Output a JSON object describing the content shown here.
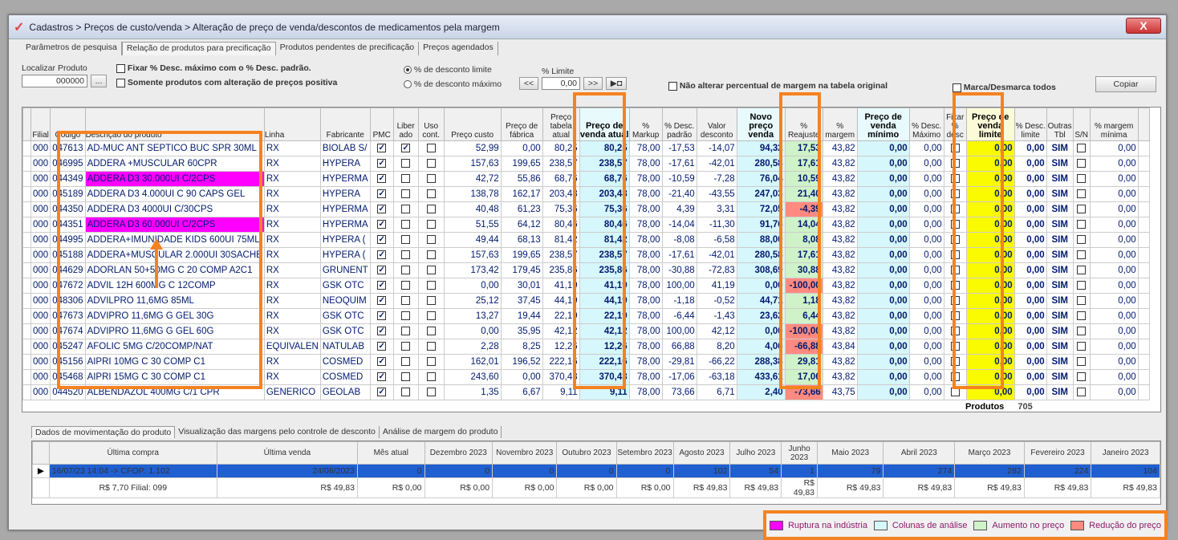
{
  "window": {
    "title": "Cadastros > Preços de custo/venda > Alteração de preço de venda/descontos de medicamentos pela margem",
    "close": "X"
  },
  "tabs": [
    "Parâmetros de pesquisa",
    "Relação de produtos para precificação",
    "Produtos pendentes de precificação",
    "Preços agendados"
  ],
  "filters": {
    "search_label": "Localizar Produto",
    "search_value": "000000",
    "search_btn": "...",
    "fix_desc": "Fixar % Desc. máximo com o % Desc. padrão.",
    "only_positive": "Somente produtos com alteração de preços positiva",
    "radio_limit": "% de desconto limite",
    "radio_max": "% de desconto máximo",
    "limit_label": "% Limite",
    "limit_value": "0,00",
    "nav_prev": "<<",
    "nav_next": ">>",
    "nav_end": "▶◘",
    "no_change_margin": "Não alterar percentual de margem na tabela original",
    "mark_all": "Marca/Desmarca todos",
    "copy_btn": "Copiar"
  },
  "grid": {
    "headers": [
      "Filial",
      "Código",
      "Descrição do produto",
      "Linha",
      "Fabricante",
      "PMC",
      "Liber ado",
      "Uso cont.",
      "Preço custo",
      "Preço de fábrica",
      "Preço tabela atual",
      "Preço de venda atual",
      "% Markup",
      "% Desc. padrão",
      "Valor desconto",
      "Novo preço venda",
      "% Reajuste",
      "% margem",
      "Preço de venda mínimo",
      "% Desc. Máximo",
      "Fixar % desc",
      "Preço de venda limite",
      "% Desc. limite",
      "Outras Tbl",
      "S/N",
      "% margem mínima"
    ],
    "rows": [
      {
        "filial": "000",
        "codigo": "047613",
        "desc": "AD-MUC ANT SEPTICO BUC SPR 30ML",
        "linha": "RX",
        "fab": "BIOLAB S/",
        "pmc": true,
        "lib": true,
        "uso": false,
        "custo": "52,99",
        "fabrica": "0,00",
        "tabela": "80,25",
        "venda": "80,25",
        "markup": "78,00",
        "descp": "-17,53",
        "valdesc": "-14,07",
        "novo": "94,32",
        "reaj": "17,53",
        "margem": "43,82",
        "minimo": "0,00",
        "descmax": "0,00",
        "fixar": false,
        "limite": "0,00",
        "desclim": "0,00",
        "outras": "SIM",
        "sn": false,
        "mmin": "0,00",
        "ruptura": false,
        "tipo": "up"
      },
      {
        "filial": "000",
        "codigo": "046995",
        "desc": "ADDERA +MUSCULAR 60CPR",
        "linha": "RX",
        "fab": "HYPERA",
        "pmc": true,
        "lib": false,
        "uso": false,
        "custo": "157,63",
        "fabrica": "199,65",
        "tabela": "238,57",
        "venda": "238,57",
        "markup": "78,00",
        "descp": "-17,61",
        "valdesc": "-42,01",
        "novo": "280,58",
        "reaj": "17,61",
        "margem": "43,82",
        "minimo": "0,00",
        "descmax": "0,00",
        "fixar": false,
        "limite": "0,00",
        "desclim": "0,00",
        "outras": "SIM",
        "sn": false,
        "mmin": "0,00",
        "ruptura": false,
        "tipo": "up"
      },
      {
        "filial": "000",
        "codigo": "044349",
        "desc": "ADDERA D3 30.000UI C/2CPS",
        "linha": "RX",
        "fab": "HYPERMA",
        "pmc": true,
        "lib": false,
        "uso": false,
        "custo": "42,72",
        "fabrica": "55,86",
        "tabela": "68,76",
        "venda": "68,76",
        "markup": "78,00",
        "descp": "-10,59",
        "valdesc": "-7,28",
        "novo": "76,04",
        "reaj": "10,59",
        "margem": "43,82",
        "minimo": "0,00",
        "descmax": "0,00",
        "fixar": false,
        "limite": "0,00",
        "desclim": "0,00",
        "outras": "SIM",
        "sn": false,
        "mmin": "0,00",
        "ruptura": true,
        "tipo": "up"
      },
      {
        "filial": "000",
        "codigo": "045189",
        "desc": "ADDERA D3 4.000UI C 90 CAPS GEL",
        "linha": "RX",
        "fab": "HYPERA",
        "pmc": true,
        "lib": false,
        "uso": false,
        "custo": "138,78",
        "fabrica": "162,17",
        "tabela": "203,48",
        "venda": "203,48",
        "markup": "78,00",
        "descp": "-21,40",
        "valdesc": "-43,55",
        "novo": "247,03",
        "reaj": "21,40",
        "margem": "43,82",
        "minimo": "0,00",
        "descmax": "0,00",
        "fixar": false,
        "limite": "0,00",
        "desclim": "0,00",
        "outras": "SIM",
        "sn": false,
        "mmin": "0,00",
        "ruptura": false,
        "tipo": "up"
      },
      {
        "filial": "000",
        "codigo": "044350",
        "desc": "ADDERA D3 4000UI C/30CPS",
        "linha": "RX",
        "fab": "HYPERMA",
        "pmc": true,
        "lib": false,
        "uso": false,
        "custo": "40,48",
        "fabrica": "61,23",
        "tabela": "75,36",
        "venda": "75,36",
        "markup": "78,00",
        "descp": "4,39",
        "valdesc": "3,31",
        "novo": "72,05",
        "reaj": "-4,39",
        "margem": "43,82",
        "minimo": "0,00",
        "descmax": "0,00",
        "fixar": false,
        "limite": "0,00",
        "desclim": "0,00",
        "outras": "SIM",
        "sn": false,
        "mmin": "0,00",
        "ruptura": false,
        "tipo": "down"
      },
      {
        "filial": "000",
        "codigo": "044351",
        "desc": "ADDERA D3 60.000UI C/2CPS",
        "linha": "RX",
        "fab": "HYPERMA",
        "pmc": true,
        "lib": false,
        "uso": false,
        "custo": "51,55",
        "fabrica": "64,12",
        "tabela": "80,46",
        "venda": "80,46",
        "markup": "78,00",
        "descp": "-14,04",
        "valdesc": "-11,30",
        "novo": "91,76",
        "reaj": "14,04",
        "margem": "43,82",
        "minimo": "0,00",
        "descmax": "0,00",
        "fixar": false,
        "limite": "0,00",
        "desclim": "0,00",
        "outras": "SIM",
        "sn": false,
        "mmin": "0,00",
        "ruptura": true,
        "tipo": "up"
      },
      {
        "filial": "000",
        "codigo": "044995",
        "desc": "ADDERA+IMUNIDADE KIDS 600UI 75ML",
        "linha": "RX",
        "fab": "HYPERA (",
        "pmc": true,
        "lib": false,
        "uso": false,
        "custo": "49,44",
        "fabrica": "68,13",
        "tabela": "81,42",
        "venda": "81,42",
        "markup": "78,00",
        "descp": "-8,08",
        "valdesc": "-6,58",
        "novo": "88,00",
        "reaj": "8,08",
        "margem": "43,82",
        "minimo": "0,00",
        "descmax": "0,00",
        "fixar": false,
        "limite": "0,00",
        "desclim": "0,00",
        "outras": "SIM",
        "sn": false,
        "mmin": "0,00",
        "ruptura": false,
        "tipo": "up"
      },
      {
        "filial": "000",
        "codigo": "045188",
        "desc": "ADDERA+MUSCULAR 2.000UI 30SACHE",
        "linha": "RX",
        "fab": "HYPERA (",
        "pmc": true,
        "lib": false,
        "uso": false,
        "custo": "157,63",
        "fabrica": "199,65",
        "tabela": "238,57",
        "venda": "238,57",
        "markup": "78,00",
        "descp": "-17,61",
        "valdesc": "-42,01",
        "novo": "280,58",
        "reaj": "17,61",
        "margem": "43,82",
        "minimo": "0,00",
        "descmax": "0,00",
        "fixar": false,
        "limite": "0,00",
        "desclim": "0,00",
        "outras": "SIM",
        "sn": false,
        "mmin": "0,00",
        "ruptura": false,
        "tipo": "up"
      },
      {
        "filial": "000",
        "codigo": "044629",
        "desc": "ADORLAN 50+50MG C 20 COMP A2C1",
        "linha": "RX",
        "fab": "GRUNENT",
        "pmc": true,
        "lib": false,
        "uso": false,
        "custo": "173,42",
        "fabrica": "179,45",
        "tabela": "235,86",
        "venda": "235,86",
        "markup": "78,00",
        "descp": "-30,88",
        "valdesc": "-72,83",
        "novo": "308,69",
        "reaj": "30,88",
        "margem": "43,82",
        "minimo": "0,00",
        "descmax": "0,00",
        "fixar": false,
        "limite": "0,00",
        "desclim": "0,00",
        "outras": "SIM",
        "sn": false,
        "mmin": "0,00",
        "ruptura": false,
        "tipo": "up"
      },
      {
        "filial": "000",
        "codigo": "047672",
        "desc": "ADVIL 12H 600MG C 12COMP",
        "linha": "RX",
        "fab": "GSK OTC",
        "pmc": true,
        "lib": false,
        "uso": false,
        "custo": "0,00",
        "fabrica": "30,01",
        "tabela": "41,19",
        "venda": "41,19",
        "markup": "78,00",
        "descp": "100,00",
        "valdesc": "41,19",
        "novo": "0,00",
        "reaj": "-100,00",
        "margem": "43,82",
        "minimo": "0,00",
        "descmax": "0,00",
        "fixar": false,
        "limite": "0,00",
        "desclim": "0,00",
        "outras": "SIM",
        "sn": false,
        "mmin": "0,00",
        "ruptura": false,
        "tipo": "down"
      },
      {
        "filial": "000",
        "codigo": "048306",
        "desc": "ADVILPRO 11,6MG 85ML",
        "linha": "RX",
        "fab": "NEOQUIM",
        "pmc": true,
        "lib": false,
        "uso": false,
        "custo": "25,12",
        "fabrica": "37,45",
        "tabela": "44,19",
        "venda": "44,19",
        "markup": "78,00",
        "descp": "-1,18",
        "valdesc": "-0,52",
        "novo": "44,71",
        "reaj": "1,18",
        "margem": "43,82",
        "minimo": "0,00",
        "descmax": "0,00",
        "fixar": false,
        "limite": "0,00",
        "desclim": "0,00",
        "outras": "SIM",
        "sn": false,
        "mmin": "0,00",
        "ruptura": false,
        "tipo": "up"
      },
      {
        "filial": "000",
        "codigo": "047673",
        "desc": "ADVIPRO 11,6MG G GEL 30G",
        "linha": "RX",
        "fab": "GSK OTC",
        "pmc": true,
        "lib": false,
        "uso": false,
        "custo": "13,27",
        "fabrica": "19,44",
        "tabela": "22,19",
        "venda": "22,19",
        "markup": "78,00",
        "descp": "-6,44",
        "valdesc": "-1,43",
        "novo": "23,62",
        "reaj": "6,44",
        "margem": "43,82",
        "minimo": "0,00",
        "descmax": "0,00",
        "fixar": false,
        "limite": "0,00",
        "desclim": "0,00",
        "outras": "SIM",
        "sn": false,
        "mmin": "0,00",
        "ruptura": false,
        "tipo": "up"
      },
      {
        "filial": "000",
        "codigo": "047674",
        "desc": "ADVIPRO 11,6MG G GEL 60G",
        "linha": "RX",
        "fab": "GSK OTC",
        "pmc": true,
        "lib": false,
        "uso": false,
        "custo": "0,00",
        "fabrica": "35,95",
        "tabela": "42,12",
        "venda": "42,12",
        "markup": "78,00",
        "descp": "100,00",
        "valdesc": "42,12",
        "novo": "0,00",
        "reaj": "-100,00",
        "margem": "43,82",
        "minimo": "0,00",
        "descmax": "0,00",
        "fixar": false,
        "limite": "0,00",
        "desclim": "0,00",
        "outras": "SIM",
        "sn": false,
        "mmin": "0,00",
        "ruptura": false,
        "tipo": "down"
      },
      {
        "filial": "000",
        "codigo": "045247",
        "desc": "AFOLIC 5MG C/20COMP/NAT",
        "linha": "EQUIVALEN",
        "fab": "NATULAB",
        "pmc": true,
        "lib": false,
        "uso": false,
        "custo": "2,28",
        "fabrica": "8,25",
        "tabela": "12,26",
        "venda": "12,26",
        "markup": "78,00",
        "descp": "66,88",
        "valdesc": "8,20",
        "novo": "4,06",
        "reaj": "-66,88",
        "margem": "43,84",
        "minimo": "0,00",
        "descmax": "0,00",
        "fixar": false,
        "limite": "0,00",
        "desclim": "0,00",
        "outras": "SIM",
        "sn": false,
        "mmin": "0,00",
        "ruptura": false,
        "tipo": "down"
      },
      {
        "filial": "000",
        "codigo": "045156",
        "desc": "AIPRI 10MG C 30 COMP C1",
        "linha": "RX",
        "fab": "COSMED",
        "pmc": true,
        "lib": false,
        "uso": false,
        "custo": "162,01",
        "fabrica": "196,52",
        "tabela": "222,16",
        "venda": "222,16",
        "markup": "78,00",
        "descp": "-29,81",
        "valdesc": "-66,22",
        "novo": "288,38",
        "reaj": "29,81",
        "margem": "43,82",
        "minimo": "0,00",
        "descmax": "0,00",
        "fixar": false,
        "limite": "0,00",
        "desclim": "0,00",
        "outras": "SIM",
        "sn": false,
        "mmin": "0,00",
        "ruptura": false,
        "tipo": "up"
      },
      {
        "filial": "000",
        "codigo": "045468",
        "desc": "AIPRI 15MG C 30 COMP C1",
        "linha": "RX",
        "fab": "COSMED",
        "pmc": true,
        "lib": false,
        "uso": false,
        "custo": "243,60",
        "fabrica": "0,00",
        "tabela": "370,43",
        "venda": "370,43",
        "markup": "78,00",
        "descp": "-17,06",
        "valdesc": "-63,18",
        "novo": "433,61",
        "reaj": "17,06",
        "margem": "43,82",
        "minimo": "0,00",
        "descmax": "0,00",
        "fixar": false,
        "limite": "0,00",
        "desclim": "0,00",
        "outras": "SIM",
        "sn": false,
        "mmin": "0,00",
        "ruptura": false,
        "tipo": "up"
      },
      {
        "filial": "000",
        "codigo": "044520",
        "desc": "ALBENDAZOL 400MG C/1 CPR",
        "linha": "GENERICO",
        "fab": "GEOLAB",
        "pmc": true,
        "lib": false,
        "uso": false,
        "custo": "1,35",
        "fabrica": "6,67",
        "tabela": "9,11",
        "venda": "9,11",
        "markup": "78,00",
        "descp": "73,66",
        "valdesc": "6,71",
        "novo": "2,40",
        "reaj": "-73,66",
        "margem": "43,75",
        "minimo": "0,00",
        "descmax": "0,00",
        "fixar": false,
        "limite": "0,00",
        "desclim": "0,00",
        "outras": "SIM",
        "sn": false,
        "mmin": "0,00",
        "ruptura": false,
        "tipo": "down"
      }
    ],
    "footer_label": "Produtos",
    "footer_count": "705"
  },
  "bottom_tabs": [
    "Dados de movimentação do produto",
    "Visualização das margens pelo controle de desconto",
    "Análise de margem do produto"
  ],
  "movement": {
    "headers": [
      "Última compra",
      "Última venda",
      "Mês atual",
      "Dezembro 2023",
      "Novembro 2023",
      "Outubro 2023",
      "Setembro 2023",
      "Agosto 2023",
      "Julho 2023",
      "Junho 2023",
      "Maio 2023",
      "Abril 2023",
      "Março 2023",
      "Fevereiro 2023",
      "Janeiro 2023"
    ],
    "row1": [
      "16/07/23 14:04 -> CFOP: 1.102",
      "24/08/2023",
      "0",
      "0",
      "0",
      "0",
      "0",
      "102",
      "54",
      "1",
      "79",
      "274",
      "282",
      "224",
      "104"
    ],
    "row2": [
      "R$ 7,70 Filial: 099",
      "R$ 49,83",
      "R$ 0,00",
      "R$ 0,00",
      "R$ 0,00",
      "R$ 0,00",
      "R$ 0,00",
      "R$ 49,83",
      "R$ 49,83",
      "R$ 49,83",
      "R$ 49,83",
      "R$ 49,83",
      "R$ 49,83",
      "R$ 49,83",
      "R$ 49,83"
    ]
  },
  "legend": {
    "ruptura": "Ruptura na indústria",
    "analise": "Colunas de análise",
    "aumento": "Aumento no preço",
    "reducao": "Redução do preço",
    "colors": {
      "ruptura": "#ff00ff",
      "analise": "#d6f7fb",
      "aumento": "#cff2c8",
      "reducao": "#ff8a80"
    }
  }
}
